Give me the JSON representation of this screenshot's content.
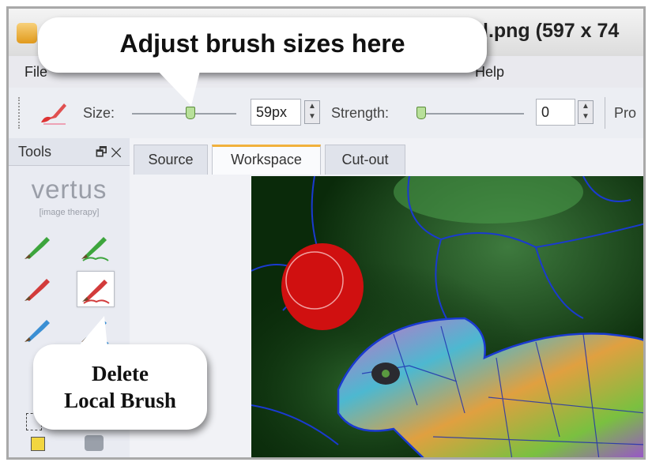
{
  "window": {
    "title": "l.png (597 x 74"
  },
  "menu": {
    "file": "File",
    "help": "Help"
  },
  "toolbar": {
    "size_label": "Size:",
    "size_value": "59px",
    "size_slider_level": 0.55,
    "strength_label": "Strength:",
    "strength_value": "0",
    "strength_slider_level": 0.0,
    "cut_label": "Pro",
    "icon": "brush-icon"
  },
  "tools": {
    "title": "Tools",
    "dock_icon": "🗗",
    "close_icon": "✕",
    "logo_main": "vertus",
    "logo_sub": "[image therapy]",
    "items": [
      {
        "name": "green-brush",
        "color": "#3da53d"
      },
      {
        "name": "green-local-brush",
        "color": "#3da53d"
      },
      {
        "name": "red-brush",
        "color": "#d23b3b"
      },
      {
        "name": "red-local-brush",
        "color": "#d23b3b",
        "selected": true
      },
      {
        "name": "blue-brush",
        "color": "#3b8fd4"
      },
      {
        "name": "blue-local-brush",
        "color": "#3b8fd4"
      }
    ]
  },
  "tabs": [
    "Source",
    "Workspace",
    "Cut-out"
  ],
  "active_tab": "Workspace",
  "callouts": {
    "top": "Adjust brush sizes here",
    "bottom_line1": "Delete",
    "bottom_line2": "Local Brush"
  }
}
